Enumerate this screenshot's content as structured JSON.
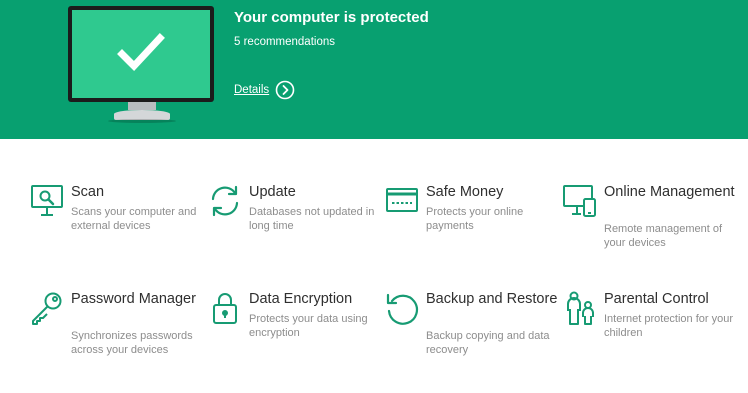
{
  "status": {
    "title": "Your computer is protected",
    "subtitle": "5 recommendations",
    "details_label": "Details"
  },
  "accent_color": "#08a070",
  "features": [
    {
      "title": "Scan",
      "description": "Scans your computer and external devices",
      "icon": "scan-monitor-icon"
    },
    {
      "title": "Update",
      "description": "Databases not updated in long time",
      "icon": "update-arrows-icon"
    },
    {
      "title": "Safe Money",
      "description": "Protects your online payments",
      "icon": "credit-card-icon"
    },
    {
      "title": "Online Management",
      "description": "Remote management of your devices",
      "icon": "devices-icon"
    },
    {
      "title": "Password Manager",
      "description": "Synchronizes passwords across your devices",
      "icon": "key-icon"
    },
    {
      "title": "Data Encryption",
      "description": "Protects your data using encryption",
      "icon": "lock-icon"
    },
    {
      "title": "Backup and Restore",
      "description": "Backup copying and data recovery",
      "icon": "backup-arrow-icon"
    },
    {
      "title": "Parental Control",
      "description": "Internet protection for your children",
      "icon": "family-icon"
    }
  ]
}
